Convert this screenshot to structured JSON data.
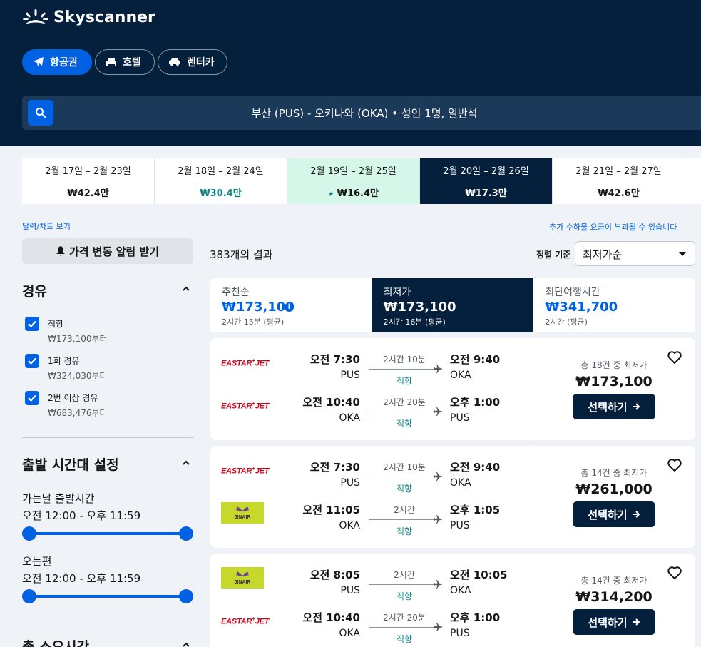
{
  "brand": {
    "name": "Skyscanner"
  },
  "nav": [
    {
      "label": "항공권",
      "icon": "plane-icon"
    },
    {
      "label": "호텔",
      "icon": "bed-icon"
    },
    {
      "label": "렌터카",
      "icon": "car-icon"
    }
  ],
  "search": {
    "summary": "부산 (PUS) - 오키나와 (OKA)  •  성인 1명, 일반석"
  },
  "date_options": [
    {
      "label": "2월 17일 – 2월 23일",
      "price": "₩42.4만",
      "state": "normal"
    },
    {
      "label": "2월 18일 – 2월 24일",
      "price": "₩30.4만",
      "state": "green"
    },
    {
      "label": "2월 19일 – 2월 25일",
      "price": "₩16.4만",
      "state": "cheapest"
    },
    {
      "label": "2월 20일 – 2월 26일",
      "price": "₩17.3만",
      "state": "selected"
    },
    {
      "label": "2월 21일 – 2월 27일",
      "price": "₩42.6만",
      "state": "normal"
    }
  ],
  "calendar_link": "달력/차트 보기",
  "fee_notice": "추가 수하물 요금이 부과될 수 있습니다",
  "price_alert": "가격 변동 알림 받기",
  "filters": {
    "stops_title": "경유",
    "stops": [
      {
        "label": "직항",
        "price": "₩173,100부터",
        "checked": true
      },
      {
        "label": "1회 경유",
        "price": "₩324,030부터",
        "checked": true
      },
      {
        "label": "2번 이상 경유",
        "price": "₩683,476부터",
        "checked": true
      }
    ],
    "time_title": "출발 시간대 설정",
    "outbound_label": "가는날 출발시간",
    "outbound_range": "오전 12:00 - 오후 11:59",
    "return_label": "오는편",
    "return_range": "오전 12:00 - 오후 11:59",
    "duration_title": "총 소요시간"
  },
  "results": {
    "count": "383개의 결과",
    "sort_label": "정렬 기준",
    "sort_value": "최저가순"
  },
  "sort_tabs": [
    {
      "label": "추천순",
      "price": "₩173,100",
      "duration": "2시간 15분 (평균)"
    },
    {
      "label": "최저가",
      "price": "₩173,100",
      "duration": "2시간 16분 (평균)"
    },
    {
      "label": "최단여행시간",
      "price": "₩341,700",
      "duration": "2시간 (평균)"
    }
  ],
  "flights": [
    {
      "legs": [
        {
          "airline": "eastar",
          "dep_time": "오전 7:30",
          "dep_code": "PUS",
          "duration": "2시간 10분",
          "stops": "직항",
          "arr_time": "오전 9:40",
          "arr_code": "OKA"
        },
        {
          "airline": "eastar",
          "dep_time": "오전 10:40",
          "dep_code": "OKA",
          "duration": "2시간 20분",
          "stops": "직항",
          "arr_time": "오후 1:00",
          "arr_code": "PUS"
        }
      ],
      "offers": "총 18건 중 최저가",
      "price": "₩173,100",
      "button": "선택하기"
    },
    {
      "legs": [
        {
          "airline": "eastar",
          "dep_time": "오전 7:30",
          "dep_code": "PUS",
          "duration": "2시간 10분",
          "stops": "직항",
          "arr_time": "오전 9:40",
          "arr_code": "OKA"
        },
        {
          "airline": "jinair",
          "dep_time": "오전 11:05",
          "dep_code": "OKA",
          "duration": "2시간",
          "stops": "직항",
          "arr_time": "오후 1:05",
          "arr_code": "PUS"
        }
      ],
      "offers": "총 14건 중 최저가",
      "price": "₩261,000",
      "button": "선택하기"
    },
    {
      "legs": [
        {
          "airline": "jinair",
          "dep_time": "오전 8:05",
          "dep_code": "PUS",
          "duration": "2시간",
          "stops": "직항",
          "arr_time": "오전 10:05",
          "arr_code": "OKA"
        },
        {
          "airline": "eastar",
          "dep_time": "오전 10:40",
          "dep_code": "OKA",
          "duration": "2시간 20분",
          "stops": "직항",
          "arr_time": "오후 1:00",
          "arr_code": "PUS"
        }
      ],
      "offers": "총 14건 중 최저가",
      "price": "₩314,200",
      "button": "선택하기"
    }
  ],
  "airline_logos": {
    "eastar_a": "EASTAR",
    "eastar_b": "JET",
    "jinair": "JINAIR"
  },
  "colors": {
    "header_bg": "#05203c",
    "accent": "#0062e3",
    "green": "#0c838a"
  }
}
